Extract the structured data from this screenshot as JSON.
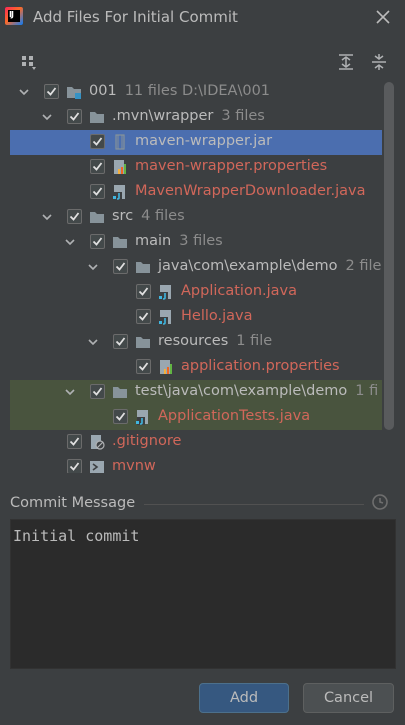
{
  "window": {
    "title": "Add Files For Initial Commit"
  },
  "tree": [
    {
      "name": "001",
      "meta": "11 files  D:\\IDEA\\001",
      "icon": "module-folder-icon",
      "expanded": true,
      "color": "white"
    },
    {
      "name": ".mvn\\wrapper",
      "meta": "3 files",
      "icon": "folder-icon",
      "expanded": true,
      "color": "white"
    },
    {
      "name": "maven-wrapper.jar",
      "meta": "",
      "icon": "jar-icon",
      "color": "white",
      "selected": true
    },
    {
      "name": "maven-wrapper.properties",
      "meta": "",
      "icon": "properties-icon",
      "color": "red"
    },
    {
      "name": "MavenWrapperDownloader.java",
      "meta": "",
      "icon": "java-file-icon",
      "color": "red"
    },
    {
      "name": "src",
      "meta": "4 files",
      "icon": "folder-icon",
      "expanded": true,
      "color": "white"
    },
    {
      "name": "main",
      "meta": "3 files",
      "icon": "folder-icon",
      "expanded": true,
      "color": "white"
    },
    {
      "name": "java\\com\\example\\demo",
      "meta": "2 file",
      "icon": "folder-icon",
      "expanded": true,
      "color": "white"
    },
    {
      "name": "Application.java",
      "meta": "",
      "icon": "java-file-icon",
      "color": "red"
    },
    {
      "name": "Hello.java",
      "meta": "",
      "icon": "java-file-icon",
      "color": "red"
    },
    {
      "name": "resources",
      "meta": "1 file",
      "icon": "folder-icon",
      "expanded": true,
      "color": "white"
    },
    {
      "name": "application.properties",
      "meta": "",
      "icon": "properties-icon",
      "color": "red"
    },
    {
      "name": "test\\java\\com\\example\\demo",
      "meta": "1 fi",
      "icon": "folder-icon",
      "expanded": true,
      "color": "white",
      "highlighted": true
    },
    {
      "name": "ApplicationTests.java",
      "meta": "",
      "icon": "java-file-icon",
      "color": "red",
      "highlighted": true
    },
    {
      "name": ".gitignore",
      "meta": "",
      "icon": "ignore-file-icon",
      "color": "red"
    },
    {
      "name": "mvnw",
      "meta": "",
      "icon": "shell-script-icon",
      "color": "red"
    }
  ],
  "commit": {
    "label": "Commit Message",
    "message": "Initial commit"
  },
  "buttons": {
    "add": "Add",
    "cancel": "Cancel"
  },
  "colors": {
    "background": "#3c3f41",
    "selection": "#4b6eaf",
    "highlight": "#49543e",
    "unversioned": "#d1675a",
    "add_button": "#365880"
  }
}
